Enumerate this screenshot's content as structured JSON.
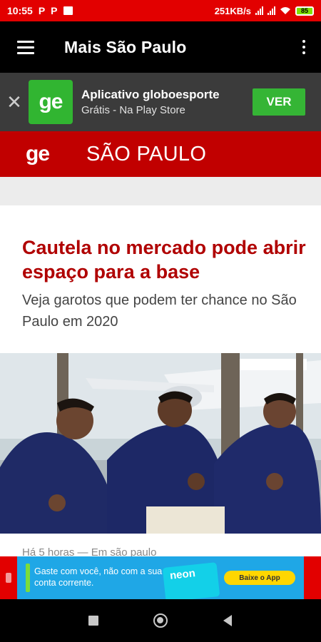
{
  "status_bar": {
    "time": "10:55",
    "notif_1": "P",
    "notif_2": "P",
    "network_speed": "251KB/s",
    "battery": "85",
    "colors": {
      "background": "#e20000"
    }
  },
  "app_bar": {
    "title": "Mais São Paulo",
    "menu_icon": "hamburger-menu-icon",
    "overflow_icon": "more-vert-icon"
  },
  "install_banner": {
    "close_symbol": "✕",
    "app_logo": "ge",
    "title": "Aplicativo globoesporte",
    "subtitle": "Grátis - Na Play Store",
    "cta": "VER",
    "colors": {
      "background": "#3b3b3b",
      "cta": "#35b535"
    }
  },
  "section_header": {
    "logo": "ge",
    "name": "SÃO PAULO",
    "colors": {
      "background": "#c10000"
    }
  },
  "article": {
    "headline": "Cautela no mercado pode abrir espaço para a base",
    "subtitle": "Veja garotos que podem ter chance no São Paulo em 2020",
    "meta": "Há 5 horas — Em são paulo",
    "colors": {
      "headline": "#b00000"
    }
  },
  "bottom_ad": {
    "text": "Gaste com você, não com a sua conta corrente.",
    "brand": "neon",
    "cta": "Baixe o App",
    "colors": {
      "background": "#1fa7e6",
      "cta": "#ffd600"
    }
  },
  "nav_bar": {
    "recents_icon": "square-recents-icon",
    "home_icon": "circle-home-icon",
    "back_icon": "triangle-back-icon"
  }
}
